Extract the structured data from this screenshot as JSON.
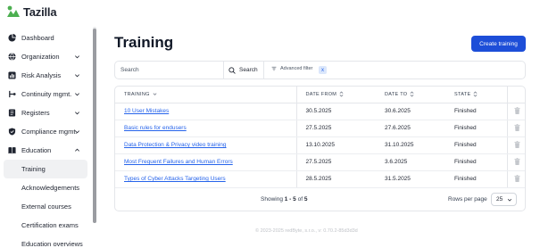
{
  "app": {
    "name": "Tazilla",
    "brand_color": "#4caf50",
    "accent": "#1d4ed8"
  },
  "sidebar": {
    "items": [
      {
        "label": "Dashboard",
        "icon": "pie-chart-icon",
        "expandable": false
      },
      {
        "label": "Organization",
        "icon": "globe-icon",
        "expandable": true
      },
      {
        "label": "Risk Analysis",
        "icon": "bar-chart-icon",
        "expandable": true
      },
      {
        "label": "Continuity mgmt.",
        "icon": "flow-icon",
        "expandable": true
      },
      {
        "label": "Registers",
        "icon": "register-icon",
        "expandable": true
      },
      {
        "label": "Compliance mgmt.",
        "icon": "shield-icon",
        "expandable": true
      },
      {
        "label": "Education",
        "icon": "book-icon",
        "expandable": true,
        "expanded": true
      }
    ],
    "education_sub": [
      {
        "label": "Training",
        "active": true
      },
      {
        "label": "Acknowledgements"
      },
      {
        "label": "External courses"
      },
      {
        "label": "Certification exams"
      },
      {
        "label": "Education overviews"
      }
    ]
  },
  "main": {
    "title": "Training",
    "create_button": "Create training",
    "search": {
      "placeholder": "Search",
      "button": "Search"
    },
    "advanced_filter": "Advanced filter",
    "filter_badge": "x"
  },
  "table": {
    "headers": [
      "TRAINING",
      "DATE FROM",
      "DATE TO",
      "STATE"
    ],
    "rows": [
      {
        "training": "10 User Mistakes",
        "date_from": "30.5.2025",
        "date_to": "30.6.2025",
        "state": "Finished"
      },
      {
        "training": "Basic rules for endusers",
        "date_from": "27.5.2025",
        "date_to": "27.6.2025",
        "state": "Finished"
      },
      {
        "training": "Data Protection & Privacy video training",
        "date_from": "13.10.2025",
        "date_to": "31.10.2025",
        "state": "Finished"
      },
      {
        "training": "Most Frequent Failures and Human Errors",
        "date_from": "27.5.2025",
        "date_to": "3.6.2025",
        "state": "Finished"
      },
      {
        "training": "Types of Cyber Attacks Targeting Users",
        "date_from": "28.5.2025",
        "date_to": "31.5.2025",
        "state": "Finished"
      }
    ],
    "footer": {
      "showing_prefix": "Showing",
      "range": "1 - 5",
      "of": "of",
      "total": "5",
      "rows_per_page_label": "Rows per page",
      "rows_per_page": "25"
    }
  },
  "copyright": "© 2023-2025 redByte, s.r.o., v: 0.70.2-85d3d3d"
}
